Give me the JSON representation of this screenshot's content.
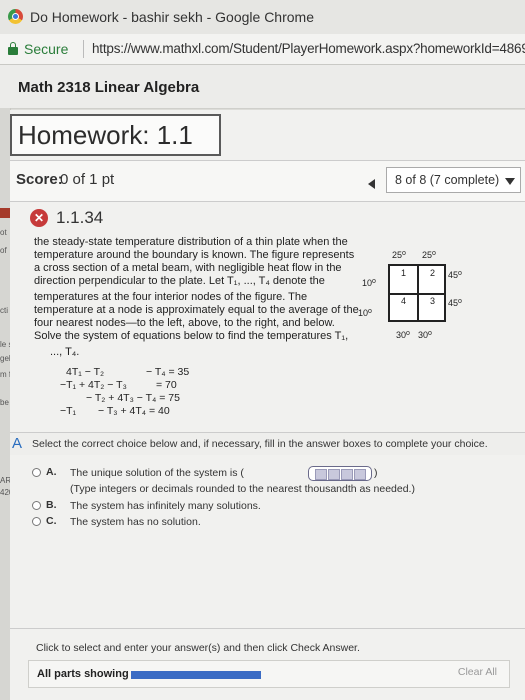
{
  "window": {
    "title": "Do Homework - bashir sekh - Google Chrome"
  },
  "address": {
    "secure_label": "Secure",
    "url": "https://www.mathxl.com/Student/PlayerHomework.aspx?homeworkId=4869392"
  },
  "course": {
    "title": "Math 2318 Linear Algebra"
  },
  "left_strip": [
    "ot",
    "of",
    "cti",
    "le s",
    "gel",
    "m f",
    "be",
    "ARA",
    "420"
  ],
  "homework": {
    "title": "Homework: 1.1"
  },
  "score": {
    "label": "Score:",
    "value": "0 of 1 pt"
  },
  "progress": {
    "text": "8 of 8 (7 complete)",
    "completed": 7,
    "total": 8
  },
  "question": {
    "number": "1.1.34",
    "status_icon": "incorrect-x-icon",
    "lines": [
      "the steady-state temperature distribution of a thin plate when the",
      "temperature around the boundary is known. The figure represents",
      "a cross section of a metal beam, with negligible heat flow in the",
      "direction perpendicular to the plate. Let T₁, ..., T₄ denote the",
      "temperatures at the four interior nodes of the figure. The",
      "temperature at a node is approximately equal to the average of the",
      "four nearest nodes—to the left, above, to the right, and below.",
      "Solve the system of equations below to find the temperatures T₁,",
      "..., T₄."
    ],
    "equations": [
      {
        "a": "4T₁ −  T₂",
        "b": "−  T₄ = 35"
      },
      {
        "a": "−T₁ + 4T₂ −  T₃",
        "b": "= 70"
      },
      {
        "a": "−  T₂ + 4T₃ −  T₄ = 75",
        "b": ""
      },
      {
        "a": "−T₁",
        "b": "−  T₃ + 4T₄ = 40"
      }
    ]
  },
  "figure": {
    "top_left": "25",
    "top_right": "25",
    "left_top": "10",
    "left_bottom": "10",
    "right_top": "45",
    "right_bottom": "45",
    "bottom_left": "30",
    "bottom_right": "30",
    "degree": "o",
    "nodes": [
      "1",
      "2",
      "4",
      "3"
    ]
  },
  "instructions": {
    "marker": "A",
    "text": "Select the correct choice below and, if necessary, fill in the answer boxes to complete your choice."
  },
  "options": [
    {
      "letter": "A.",
      "text": "The unique solution of the system is (",
      "close": ")",
      "note": "(Type integers or decimals rounded to the nearest thousandth as needed.)"
    },
    {
      "letter": "B.",
      "text": "The system has infinitely many solutions."
    },
    {
      "letter": "C.",
      "text": "The system has no solution."
    }
  ],
  "footer": {
    "hint": "Click to select and enter your answer(s) and then click Check Answer.",
    "parts_label": "All parts showing",
    "parts_progress": 1.0,
    "clear_label": "Clear All"
  },
  "colors": {
    "accent": "#3a6bc4",
    "incorrect": "#c63a3a",
    "secure": "#2a7d3a"
  }
}
